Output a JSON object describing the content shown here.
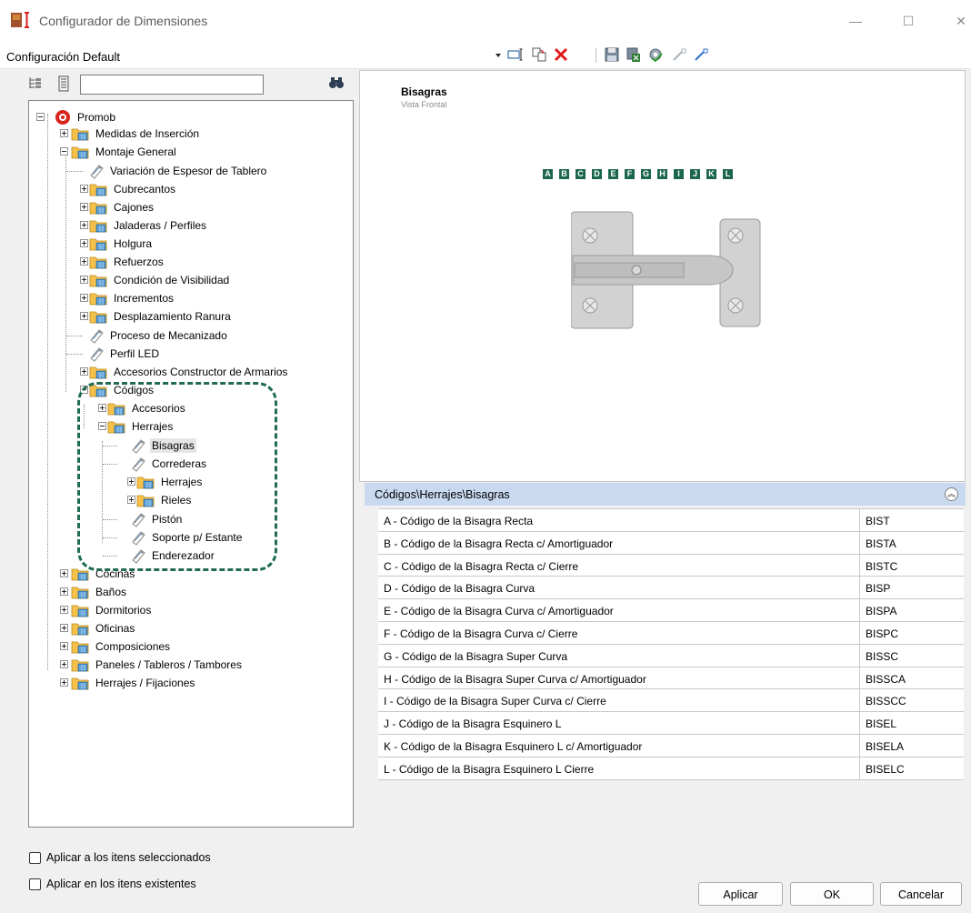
{
  "window": {
    "title": "Configurador de Dimensiones",
    "min_glyph": "—",
    "max_glyph": "☐",
    "close_glyph": "✕"
  },
  "config": {
    "label": "Configuración Default"
  },
  "search": {
    "value": ""
  },
  "tree": {
    "root": "Promob",
    "medidas": "Medidas de Inserción",
    "montaje": "Montaje General",
    "variacion": "Variación de Espesor de Tablero",
    "cubrecantos": "Cubrecantos",
    "cajones": "Cajones",
    "jaladeras": "Jaladeras / Perfiles",
    "holgura": "Holgura",
    "refuerzos": "Refuerzos",
    "condicion": "Condición de Visibilidad",
    "incrementos": "Incrementos",
    "desplazamiento": "Desplazamiento Ranura",
    "proceso": "Proceso de Mecanizado",
    "perfil": "Perfil LED",
    "accesorios_constructor": "Accesorios Constructor de Armarios",
    "codigos": "Códigos",
    "accesorios": "Accesorios",
    "herrajes": "Herrajes",
    "bisagras": "Bisagras",
    "correderas": "Correderas",
    "herrajes_sub": "Herrajes",
    "rieles": "Rieles",
    "piston": "Pistón",
    "soporte": "Soporte p/ Estante",
    "enderezador": "Enderezador",
    "cocinas": "Cocinas",
    "banos": "Baños",
    "dormitorios": "Dormitorios",
    "oficinas": "Oficinas",
    "composiciones": "Composiciones",
    "paneles": "Paneles / Tableros / Tambores",
    "herrajes_fij": "Herrajes / Fijaciones"
  },
  "checkboxes": {
    "selected": "Aplicar a los itens seleccionados",
    "existing": "Aplicar en los itens existentes"
  },
  "preview": {
    "title": "Bisagras",
    "subtitle": "Vista Frontal",
    "letters": [
      "A",
      "B",
      "C",
      "D",
      "E",
      "F",
      "G",
      "H",
      "I",
      "J",
      "K",
      "L"
    ]
  },
  "properties": {
    "path": "Códigos\\Herrajes\\Bisagras",
    "rows": [
      {
        "name": "A - Código de la Bisagra Recta",
        "value": "BIST"
      },
      {
        "name": "B - Código de la Bisagra Recta c/ Amortiguador",
        "value": "BISTA"
      },
      {
        "name": "C - Código de la Bisagra Recta c/ Cierre",
        "value": "BISTC"
      },
      {
        "name": "D - Código de la Bisagra Curva",
        "value": "BISP"
      },
      {
        "name": "E - Código de la Bisagra Curva c/ Amortiguador",
        "value": "BISPA"
      },
      {
        "name": "F - Código de la Bisagra Curva c/ Cierre",
        "value": "BISPC"
      },
      {
        "name": "G - Código de la Bisagra Super Curva",
        "value": "BISSC"
      },
      {
        "name": "H - Código de la Bisagra Super Curva c/ Amortiguador",
        "value": "BISSCA"
      },
      {
        "name": "I - Código de la Bisagra Super Curva c/ Cierre",
        "value": "BISSCC"
      },
      {
        "name": "J - Código de la Bisagra Esquinero L",
        "value": "BISEL"
      },
      {
        "name": "K - Código de la Bisagra Esquinero L c/ Amortiguador",
        "value": "BISELA"
      },
      {
        "name": "L - Código de la Bisagra Esquinero L Cierre",
        "value": "BISELC"
      }
    ]
  },
  "buttons": {
    "apply": "Aplicar",
    "ok": "OK",
    "cancel": "Cancelar"
  },
  "colors": {
    "accent": "#1c6650",
    "header": "#c9daf0",
    "highlight": "#1f6b54"
  },
  "icons": [
    "app-icon",
    "dropdown-arrow-icon",
    "rename-icon",
    "copy-icon",
    "delete-icon",
    "save-icon",
    "export-icon",
    "gear-icon",
    "pipette-icon",
    "pipette-add-icon",
    "collapse-all-icon",
    "expand-all-icon",
    "binoculars-icon",
    "folder-icon",
    "tag-icon",
    "collapse-up-icon"
  ]
}
